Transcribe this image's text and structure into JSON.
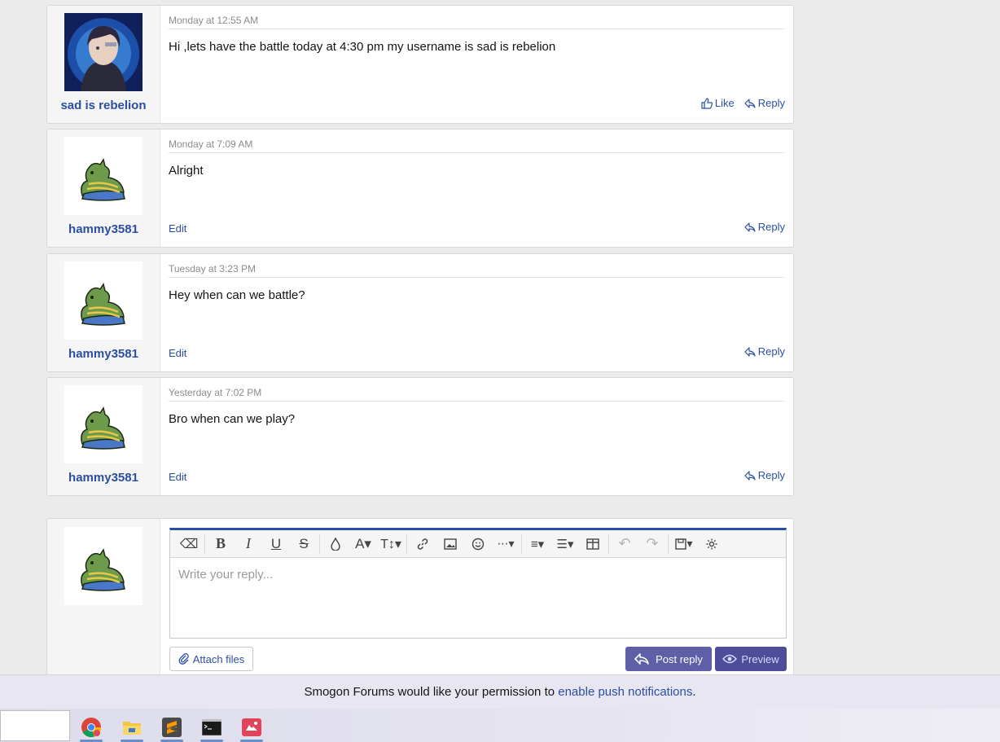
{
  "posts": [
    {
      "username": "sad is rebelion",
      "date": "Monday at 12:55 AM",
      "body": "Hi ,lets have the battle today at 4:30 pm my username is sad is rebelion",
      "like_label": "Like",
      "reply_label": "Reply",
      "edit_label": ""
    },
    {
      "username": "hammy3581",
      "date": "Monday at 7:09 AM",
      "body": "Alright",
      "edit_label": "Edit",
      "reply_label": "Reply",
      "like_label": ""
    },
    {
      "username": "hammy3581",
      "date": "Tuesday at 3:23 PM",
      "body": "Hey when can we battle?",
      "edit_label": "Edit",
      "reply_label": "Reply",
      "like_label": ""
    },
    {
      "username": "hammy3581",
      "date": "Yesterday at 7:02 PM",
      "body": "Bro when can we play?",
      "edit_label": "Edit",
      "reply_label": "Reply",
      "like_label": ""
    }
  ],
  "reply_box": {
    "placeholder": "Write your reply...",
    "attach_label": "Attach files",
    "post_label": "Post reply",
    "preview_label": "Preview"
  },
  "notice": {
    "text": "Smogon Forums would like your permission to",
    "link": "enable push notifications",
    "suffix": "."
  },
  "colors": {
    "accent": "#2b4ea2",
    "button": "#5f5fa8",
    "button_dark": "#4d4d99"
  },
  "taskbar_apps": [
    "chrome-icon",
    "file-explorer-icon",
    "sublime-text-icon",
    "terminal-icon",
    "game-icon"
  ]
}
